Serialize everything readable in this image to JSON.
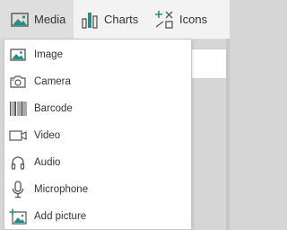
{
  "toolbar": {
    "tabs": [
      {
        "label": "Media",
        "icon": "image-icon",
        "selected": true
      },
      {
        "label": "Charts",
        "icon": "bar-chart-icon",
        "selected": false
      },
      {
        "label": "Icons",
        "icon": "icons-icon",
        "selected": false
      }
    ]
  },
  "menu": {
    "items": [
      {
        "label": "Image",
        "icon": "image-icon"
      },
      {
        "label": "Camera",
        "icon": "camera-icon"
      },
      {
        "label": "Barcode",
        "icon": "barcode-icon"
      },
      {
        "label": "Video",
        "icon": "video-icon"
      },
      {
        "label": "Audio",
        "icon": "headphones-icon"
      },
      {
        "label": "Microphone",
        "icon": "microphone-icon"
      },
      {
        "label": "Add picture",
        "icon": "add-picture-icon"
      }
    ]
  },
  "colors": {
    "selected_tab_bg": "#dedede",
    "toolbar_bg": "#f3f3f3",
    "menu_bg": "#ffffff",
    "icon_teal": "#2f8c84",
    "icon_gray": "#555555"
  }
}
